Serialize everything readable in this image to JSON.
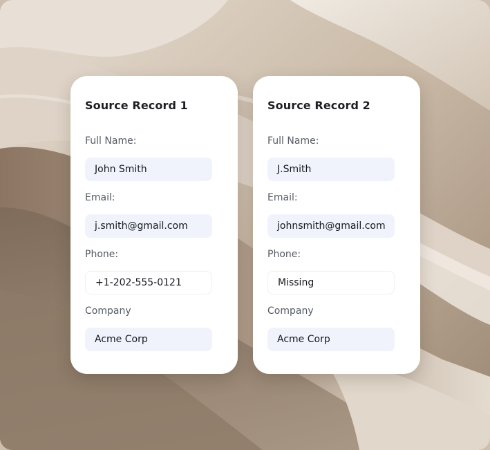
{
  "records": [
    {
      "title": "Source Record 1",
      "fields": [
        {
          "label": "Full Name:",
          "value": "John Smith"
        },
        {
          "label": "Email:",
          "value": "j.smith@gmail.com"
        },
        {
          "label": "Phone:",
          "value": "+1-202-555-0121"
        },
        {
          "label": "Company",
          "value": "Acme Corp"
        }
      ]
    },
    {
      "title": "Source Record 2",
      "fields": [
        {
          "label": "Full Name:",
          "value": "J.Smith"
        },
        {
          "label": "Email:",
          "value": "johnsmith@gmail.com"
        },
        {
          "label": "Phone:",
          "value": "Missing"
        },
        {
          "label": "Company",
          "value": "Acme Corp"
        }
      ]
    }
  ],
  "colors": {
    "card_background": "#ffffff",
    "field_fill": "#f1f3fc",
    "text_primary": "#16181d",
    "text_label": "#555a63",
    "backdrop_sand": "#cdbfae"
  }
}
